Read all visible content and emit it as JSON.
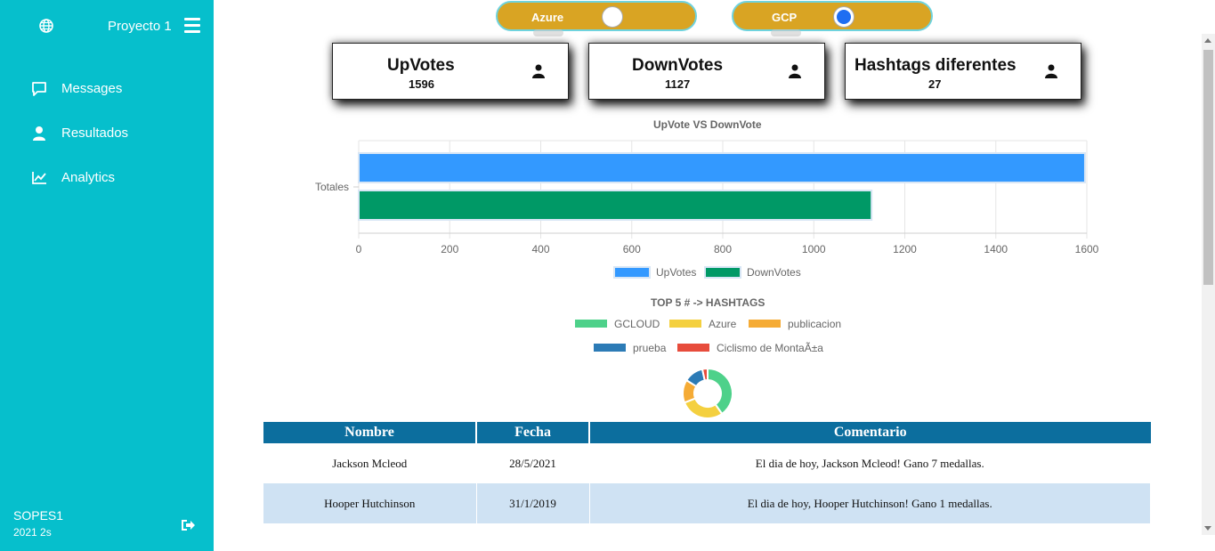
{
  "sidebar": {
    "title": "Proyecto 1",
    "items": [
      {
        "label": "Messages",
        "icon": "message-icon"
      },
      {
        "label": "Resultados",
        "icon": "user-icon"
      },
      {
        "label": "Analytics",
        "icon": "chart-line-icon"
      }
    ],
    "footer_title": "SOPES1",
    "footer_sub": "2021 2s",
    "bg_color": "#06bfcc"
  },
  "toggles": [
    {
      "label": "Azure",
      "on": false
    },
    {
      "label": "GCP",
      "on": true
    }
  ],
  "cards": [
    {
      "title": "UpVotes",
      "value": "1596"
    },
    {
      "title": "DownVotes",
      "value": "1127"
    },
    {
      "title": "Hashtags diferentes",
      "value": "27"
    }
  ],
  "chart_data": [
    {
      "type": "bar",
      "orientation": "horizontal",
      "title": "UpVote VS DownVote",
      "categories": [
        "Totales"
      ],
      "series": [
        {
          "name": "UpVotes",
          "values": [
            1596
          ],
          "color": "#3399ff"
        },
        {
          "name": "DownVotes",
          "values": [
            1127
          ],
          "color": "#009966"
        }
      ],
      "xlim": [
        0,
        1600
      ],
      "xticks": [
        "0",
        "200",
        "400",
        "600",
        "800",
        "1000",
        "1200",
        "1400",
        "1600"
      ],
      "grid": true,
      "legend": "bottom"
    },
    {
      "type": "pie",
      "variant": "doughnut",
      "title": "TOP 5 # -> HASHTAGS",
      "categories": [
        "GCLOUD",
        "Azure",
        "publicacion",
        "prueba",
        "Ciclismo de MontaÃ±a"
      ],
      "values": [
        35,
        25,
        13,
        11,
        3
      ],
      "colors": [
        "#4ed18a",
        "#f4d03f",
        "#f5ab35",
        "#2c7bb6",
        "#e74c3c"
      ],
      "legend": "top"
    }
  ],
  "table": {
    "headers": [
      "Nombre",
      "Fecha",
      "Comentario"
    ],
    "rows": [
      [
        "Jackson Mcleod",
        "28/5/2021",
        "El dia de hoy, Jackson Mcleod! Gano 7 medallas."
      ],
      [
        "Hooper Hutchinson",
        "31/1/2019",
        "El dia de hoy, Hooper Hutchinson! Gano 1 medallas."
      ]
    ],
    "header_color": "#0c6e9e"
  }
}
